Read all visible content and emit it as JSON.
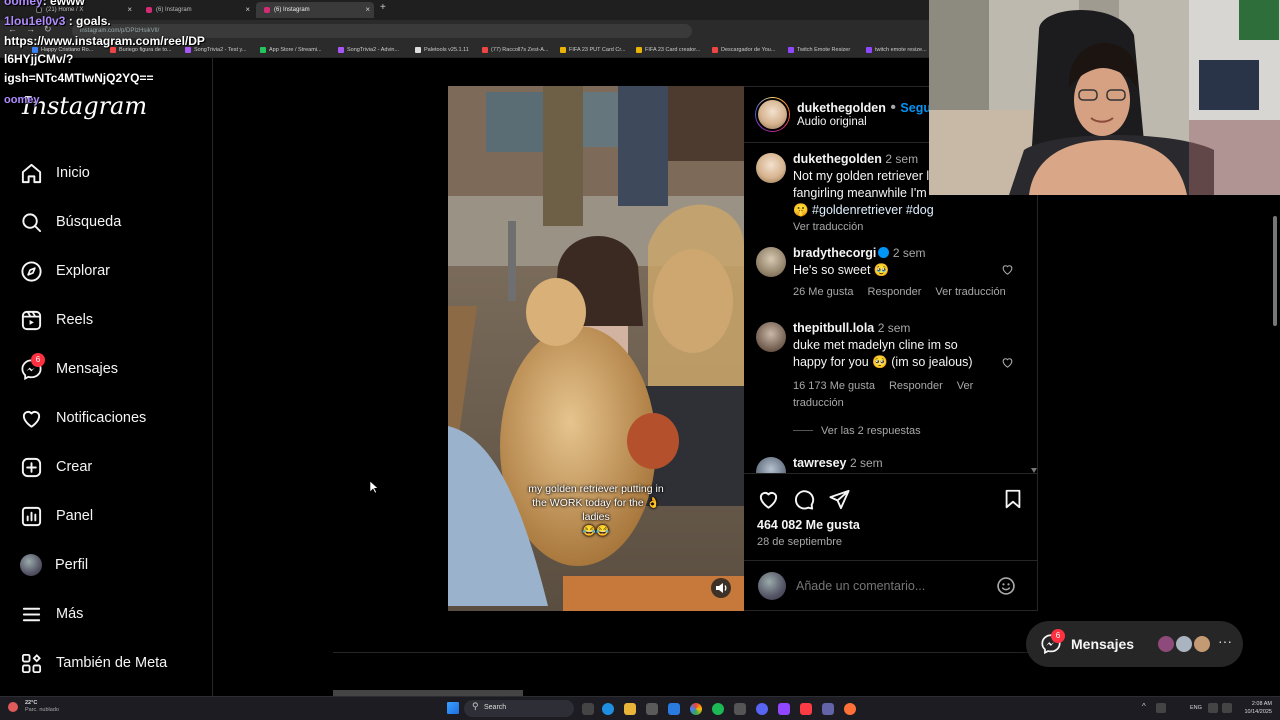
{
  "browser": {
    "tabs": [
      {
        "label": "(21) Home / X",
        "active": false
      },
      {
        "label": "(6) Instagram",
        "active": false
      },
      {
        "label": "(6) Instagram",
        "active": true
      }
    ],
    "url": "instagram.com/p/DPIzHsikVlI/",
    "bookmarks": [
      "Happy Cristiano Ro...",
      "Buriego figura de to...",
      "SongTrivia2 - Test y...",
      "App Store / Streami...",
      "SongTrivia2 - Advin...",
      "Paletools v25.1.11",
      "(77) Raccoll7s Zest-A...",
      "FIFA 23 PUT Card Cr...",
      "FIFA 23 Card creator...",
      "Descargador de You...",
      "Twitch Emote Resizer",
      "twitch emote resize..."
    ]
  },
  "chat_overlay": {
    "line1_user": "oomey",
    "line1_msg": ": ewww",
    "line2_user": "1lou1el0v3",
    "line2_msg": " : goals.",
    "line3": "https://www.instagram.com/reel/DP",
    "line4": "l6HYjjCMv/?",
    "line5": "igsh=NTc4MTIwNjQ2YQ==",
    "line6": "oomey"
  },
  "sidebar": {
    "logo": "Instagram",
    "items": [
      {
        "label": "Inicio",
        "icon": "home-icon"
      },
      {
        "label": "Búsqueda",
        "icon": "search-icon"
      },
      {
        "label": "Explorar",
        "icon": "compass-icon"
      },
      {
        "label": "Reels",
        "icon": "reels-icon"
      },
      {
        "label": "Mensajes",
        "icon": "messenger-icon",
        "badge": "6"
      },
      {
        "label": "Notificaciones",
        "icon": "heart-icon"
      },
      {
        "label": "Crear",
        "icon": "plus-square-icon"
      },
      {
        "label": "Panel",
        "icon": "chart-icon"
      },
      {
        "label": "Perfil",
        "icon": "avatar"
      },
      {
        "label": "Más",
        "icon": "menu-icon"
      },
      {
        "label": "También de Meta",
        "icon": "meta-apps-icon"
      }
    ]
  },
  "post": {
    "media_caption_line1": "my golden retriever putting in",
    "media_caption_line2": "the WORK today for the 👌",
    "media_caption_line3": "ladies",
    "media_caption_line4": "😂😂",
    "header": {
      "username": "dukethegolden",
      "separator": " • ",
      "follow_label": "Seguir",
      "audio": "Audio original"
    },
    "caption": {
      "username": "dukethegolden",
      "time": "2 sem",
      "text_line1": "Not my golden retriever l",
      "text_line2": "fangirling meanwhile I'm",
      "hashtags": "🤫 #goldenretriever #dog",
      "translate": "Ver traducción"
    },
    "comments": [
      {
        "username": "bradythecorgi",
        "time": "2 sem",
        "text": "He's so sweet 🥹",
        "likes": "26 Me gusta",
        "reply": "Responder",
        "translate": "Ver traducción"
      },
      {
        "username": "thepitbull.lola",
        "time": "2 sem",
        "text": "duke met madelyn cline im so happy for you 🥺 (im so jealous)",
        "likes": "16 173 Me gusta",
        "reply": "Responder",
        "translate": "Ver traducción",
        "replies": "Ver las 2 respuestas"
      },
      {
        "username": "tawresey",
        "time": "2 sem"
      }
    ],
    "likes_count": "464 082 Me gusta",
    "date": "28 de septiembre",
    "comment_placeholder": "Añade un comentario...",
    "emoji_icon": "smile-icon"
  },
  "messages_pill": {
    "label": "Mensajes",
    "badge": "6"
  },
  "taskbar": {
    "weather_temp": "22°C",
    "weather_desc": "Parc. nublado",
    "search_label": "Search",
    "lang": "ENG",
    "time": "2:08 AM",
    "date": "10/14/2025"
  },
  "colors": {
    "accent": "#0095f6",
    "badge": "#ff3040",
    "background": "#000000",
    "border": "#262626"
  }
}
